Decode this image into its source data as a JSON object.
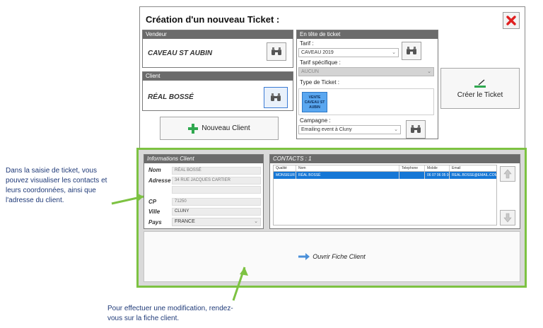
{
  "dialog": {
    "title": "Création d'un nouveau Ticket :"
  },
  "vendeur": {
    "header": "Vendeur",
    "value": "CAVEAU ST AUBIN"
  },
  "client": {
    "header": "Client",
    "value": "RÉAL BOSSÉ"
  },
  "nouveau_client_label": "Nouveau Client",
  "entete": {
    "header": "En tête de ticket",
    "tarif_label": "Tarif :",
    "tarif_value": "CAVEAU 2019",
    "tarif_specifique_label": "Tarif spécifique :",
    "tarif_specifique_value": "AUCUN",
    "type_label": "Type de Ticket :",
    "type_tile": "VENTE CAVEAU ST AUBIN",
    "campagne_label": "Campagne :",
    "campagne_value": "Emailing event à Cluny"
  },
  "creer_ticket_label": "Créer le Ticket",
  "informations": {
    "header": "Informations Client",
    "nom_label": "Nom",
    "nom_value": "RÉAL BOSSÉ",
    "adresse_label": "Adresse",
    "adresse_value": "34 RUE JACQUES CARTIER",
    "cp_label": "CP",
    "cp_value": "71250",
    "ville_label": "Ville",
    "ville_value": "CLUNY",
    "pays_label": "Pays",
    "pays_value": "FRANCE"
  },
  "contacts": {
    "header": "CONTACTS : 1",
    "columns": [
      "Qualité",
      "Nom",
      "Telephone",
      "Mobile",
      "Email"
    ],
    "rows": [
      [
        "MONSIEUR",
        "RÉAL BOSSÉ",
        "",
        "06 07 06 05 04",
        "REAL.BOSSE@EMAIL.COM"
      ]
    ]
  },
  "ouvrir_fiche_label": "Ouvrir Fiche Client",
  "annotations": {
    "left": "Dans la saisie de ticket, vous pouvez visualiser les contacts et leurs coordonnées, ainsi que l'adresse du client.",
    "bottom": "Pour effectuer une modification, rendez-vous sur la fiche client."
  },
  "colors": {
    "accent_green": "#7dc242",
    "selection_blue": "#1577d6",
    "close_red": "#e02020",
    "annotation_text": "#1f3a78"
  },
  "icons": [
    "close-icon",
    "binoculars-icon",
    "plus-icon",
    "pen-icon",
    "arrow-right-icon",
    "arrow-up-icon",
    "arrow-down-icon"
  ]
}
